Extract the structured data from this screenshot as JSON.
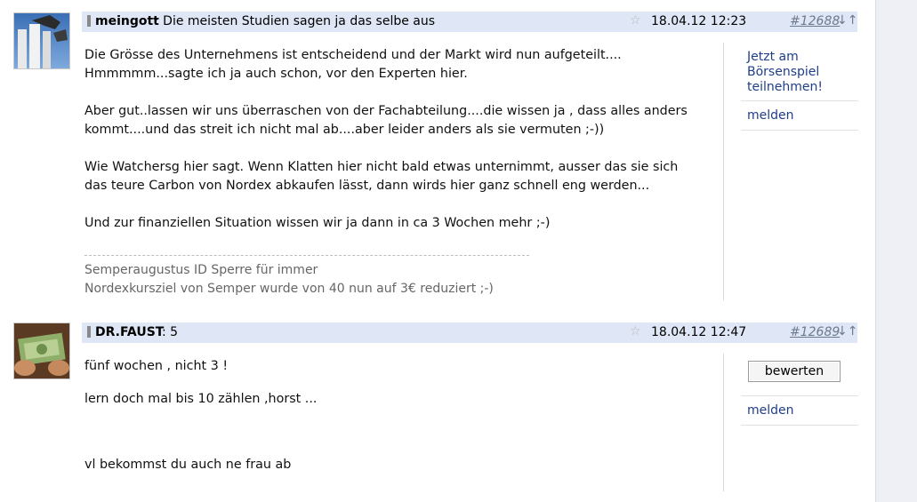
{
  "posts": [
    {
      "author": "meingott",
      "subject": ": Die meisten Studien sagen ja das selbe aus",
      "date": "18.04.12 12:23",
      "post_no": "#12688",
      "arrows": "↓↑",
      "paragraphs": [
        "Die Grösse des Unternehmens ist entscheidend und der Markt wird nun aufgeteilt....",
        "Hmmmmm...sagte ich ja auch schon, vor den Experten hier.",
        "Aber gut..lassen wir uns überraschen von der Fachabteilung....die wissen ja , dass alles anders",
        "kommt....und das streit ich nicht mal ab....aber leider anders als sie vermuten ;-))",
        "Wie Watchersg hier sagt. Wenn Klatten hier nicht bald etwas unternimmt, ausser das sie sich",
        "das teure Carbon von Nordex abkaufen lässt, dann wirds hier ganz schnell eng werden...",
        "Und zur finanziellen Situation wissen wir ja dann in ca 3 Wochen mehr ;-)"
      ],
      "signature": [
        "Semperaugustus ID Sperre für immer",
        "Nordexkursziel  von Semper wurde von 40 nun auf 3€ reduziert ;-)"
      ],
      "sidebar": {
        "promo_link": [
          "Jetzt am",
          "Börsenspiel",
          "teilnehmen!"
        ],
        "report_link": "melden"
      }
    },
    {
      "author": "DR.FAUST",
      "subject": ": 5",
      "date": "18.04.12 12:47",
      "post_no": "#12689",
      "arrows": "↓↑",
      "paragraphs": [
        "fünf   wochen , nicht  3 !",
        "lern doch mal bis  10 zählen ,horst  ...",
        "vl bekommst  du auch ne frau ab"
      ],
      "sidebar": {
        "rate_button": "bewerten",
        "report_link": "melden"
      }
    }
  ],
  "icons": {
    "star": "☆",
    "status_bar_color": "#8a8a8a",
    "link_color": "#1f3d8a",
    "header_bg": "#dfe6f5"
  }
}
